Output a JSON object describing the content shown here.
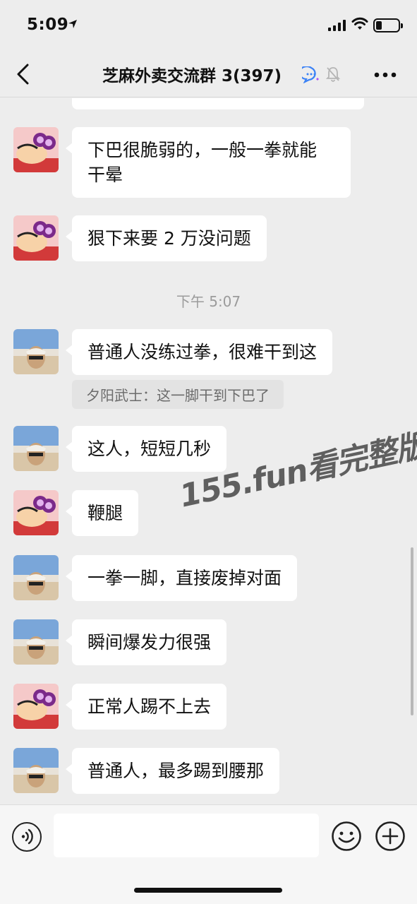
{
  "status_bar": {
    "time": "5:09"
  },
  "nav": {
    "title": "芝麻外卖交流群 3(397)",
    "back_icon": "chevron-left-icon",
    "group_icon": "group-chat-icon",
    "mute_icon": "bell-muted-icon",
    "more_icon": "ellipsis-icon"
  },
  "messages": [
    {
      "avatar": "cartoon",
      "text": "下巴很脆弱的，一般一拳就能\n干晕"
    },
    {
      "avatar": "cartoon",
      "text": "狠下来要 2 万没问题"
    },
    {
      "timestamp": "下午 5:07"
    },
    {
      "avatar": "photo",
      "text": "普通人没练过拳，很难干到这",
      "quote": "夕阳武士：这一脚干到下巴了"
    },
    {
      "avatar": "photo",
      "text": "这人，短短几秒"
    },
    {
      "avatar": "cartoon",
      "text": "鞭腿"
    },
    {
      "avatar": "photo",
      "text": "一拳一脚，直接废掉对面"
    },
    {
      "avatar": "photo",
      "text": "瞬间爆发力很强"
    },
    {
      "avatar": "cartoon",
      "text": "正常人踢不上去"
    },
    {
      "avatar": "photo",
      "text": "普通人，最多踢到腰那"
    }
  ],
  "watermark": "155.fun看完整版",
  "input_bar": {
    "voice_icon": "voice-icon",
    "emoji_icon": "emoji-icon",
    "plus_icon": "plus-circle-icon",
    "value": ""
  },
  "colors": {
    "background": "#ededed",
    "bubble": "#ffffff",
    "timestamp": "#9b9b9b",
    "quote_bg": "#e3e3e3"
  }
}
